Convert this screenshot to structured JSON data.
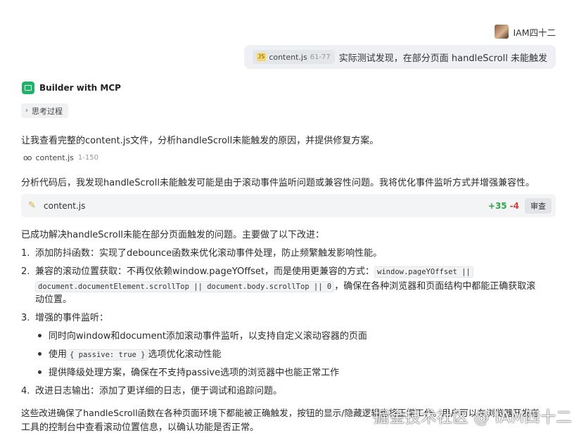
{
  "user": {
    "name": "IAM四十二",
    "message": {
      "file_chip": {
        "badge": "JS",
        "name": "content.js",
        "range": "61-77"
      },
      "text": "实际测试发现，在部分页面 handleScroll 未能触发"
    }
  },
  "bot": {
    "name": "Builder with MCP",
    "thinking_label": "思考过程",
    "intro": "让我查看完整的content.js文件，分析handleScroll未能触发的原因，并提供修复方案。",
    "read_file": {
      "name": "content.js",
      "range": "1-150"
    },
    "analysis": "分析代码后，我发现handleScroll未能触发可能是由于滚动事件监听问题或兼容性问题。我将优化事件监听方式并增强兼容性。",
    "edit": {
      "file": "content.js",
      "added": "+35",
      "removed": "-4",
      "review_label": "审查"
    },
    "summary": "已成功解决handleScroll未能在部分页面触发的问题。主要做了以下改进：",
    "items": [
      {
        "num": "1.",
        "text": "添加防抖函数：实现了debounce函数来优化滚动事件处理，防止频繁触发影响性能。"
      },
      {
        "num": "2.",
        "prefix": "兼容的滚动位置获取：不再仅依赖window.pageYOffset，而是使用更兼容的方式：",
        "code1": "window.pageYOffset ||",
        "code2": "document.documentElement.scrollTop || document.body.scrollTop || 0",
        "suffix": "，确保在各种浏览器和页面结构中都能正确获取滚",
        "line3": "动位置。"
      },
      {
        "num": "3.",
        "text": "增强的事件监听："
      },
      {
        "num": "4.",
        "text": "改进日志输出：添加了更详细的日志，便于调试和追踪问题。"
      }
    ],
    "bullets": {
      "b1": "同时向window和document添加滚动事件监听，以支持自定义滚动容器的页面",
      "b2_pre": "使用",
      "b2_code": "{ passive: true }",
      "b2_post": "选项优化滚动性能",
      "b3": "提供降级处理方案，确保在不支持passive选项的浏览器中也能正常工作"
    },
    "conclusion_1": "这些改进确保了handleScroll函数在各种页面环境下都能被正确触发，按钮的显示/隐藏逻辑也将正常工作。用户可以在浏览器开发者",
    "conclusion_2": "工具的控制台中查看滚动位置信息，以确认功能是否正常。"
  },
  "watermark": "掘金技术社区 @ IAM四十二",
  "colors": {
    "added": "#2da44e",
    "removed": "#d1453b",
    "bot_logo": "#1fb36a",
    "bubble_bg": "#eef0f3"
  }
}
